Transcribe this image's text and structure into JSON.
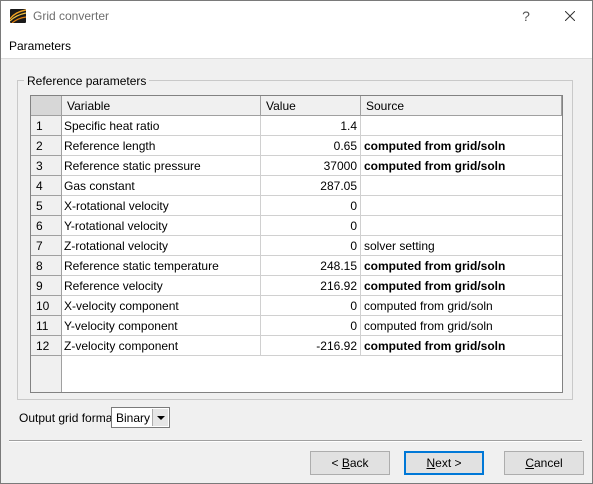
{
  "window": {
    "title": "Grid converter",
    "help_glyph": "?",
    "close_glyph": "✕"
  },
  "header": {
    "title": "Parameters"
  },
  "group": {
    "title": "Reference parameters"
  },
  "table": {
    "columns": [
      "Variable",
      "Value",
      "Source"
    ],
    "rows": [
      {
        "n": "1",
        "variable": "Specific heat ratio",
        "value": "1.4",
        "source": "",
        "source_bold": false
      },
      {
        "n": "2",
        "variable": "Reference length",
        "value": "0.65",
        "source": "computed from grid/soln",
        "source_bold": true
      },
      {
        "n": "3",
        "variable": "Reference static pressure",
        "value": "37000",
        "source": "computed from grid/soln",
        "source_bold": true
      },
      {
        "n": "4",
        "variable": "Gas constant",
        "value": "287.05",
        "source": "",
        "source_bold": false
      },
      {
        "n": "5",
        "variable": "X-rotational velocity",
        "value": "0",
        "source": "",
        "source_bold": false
      },
      {
        "n": "6",
        "variable": "Y-rotational velocity",
        "value": "0",
        "source": "",
        "source_bold": false
      },
      {
        "n": "7",
        "variable": "Z-rotational velocity",
        "value": "0",
        "source": "solver setting",
        "source_bold": false
      },
      {
        "n": "8",
        "variable": "Reference static temperature",
        "value": "248.15",
        "source": "computed from grid/soln",
        "source_bold": true
      },
      {
        "n": "9",
        "variable": "Reference velocity",
        "value": "216.92",
        "source": "computed from grid/soln",
        "source_bold": true
      },
      {
        "n": "10",
        "variable": "X-velocity component",
        "value": "0",
        "source": "computed from grid/soln",
        "source_bold": false
      },
      {
        "n": "11",
        "variable": "Y-velocity component",
        "value": "0",
        "source": "computed from grid/soln",
        "source_bold": false
      },
      {
        "n": "12",
        "variable": "Z-velocity component",
        "value": "-216.92",
        "source": "computed from grid/soln",
        "source_bold": true
      }
    ]
  },
  "output": {
    "label": "Output grid format",
    "selected": "Binary"
  },
  "buttons": {
    "back": {
      "pre": "< ",
      "accel": "B",
      "rest": "ack"
    },
    "next": {
      "accel": "N",
      "rest": "ext >"
    },
    "cancel": {
      "accel": "C",
      "rest": "ancel"
    }
  }
}
